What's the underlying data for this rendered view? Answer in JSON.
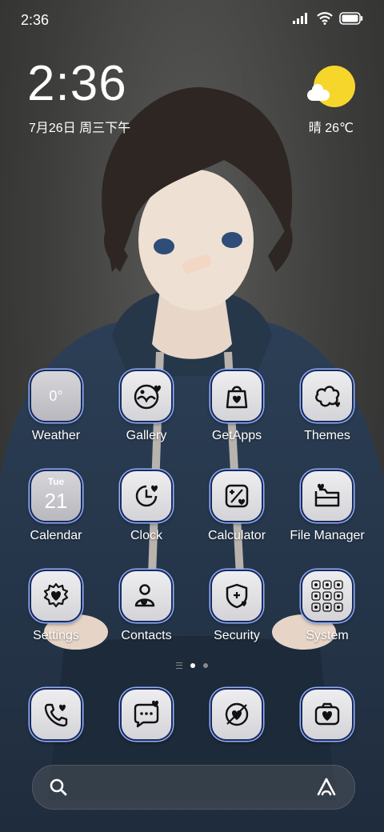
{
  "status_bar": {
    "time": "2:36",
    "icons": [
      "signal-icon",
      "wifi-icon",
      "battery-icon"
    ]
  },
  "clock_widget": {
    "time": "2:36",
    "date": "7月26日 周三下午",
    "weather": "晴 26℃",
    "weather_icon": "sunny-cloud-icon"
  },
  "apps": [
    {
      "label": "Weather",
      "icon": "weather-icon",
      "text": "0°"
    },
    {
      "label": "Gallery",
      "icon": "gallery-icon"
    },
    {
      "label": "GetApps",
      "icon": "shopping-bag-icon"
    },
    {
      "label": "Themes",
      "icon": "themes-icon"
    },
    {
      "label": "Calendar",
      "icon": "calendar-icon",
      "day": "Tue",
      "date": "21"
    },
    {
      "label": "Clock",
      "icon": "clock-icon"
    },
    {
      "label": "Calculator",
      "icon": "calculator-icon"
    },
    {
      "label": "File Manager",
      "icon": "folder-icon"
    },
    {
      "label": "Settings",
      "icon": "gear-icon"
    },
    {
      "label": "Contacts",
      "icon": "contacts-icon"
    },
    {
      "label": "Security",
      "icon": "shield-icon"
    },
    {
      "label": "System",
      "icon": "app-folder-icon"
    }
  ],
  "dock": [
    {
      "icon": "phone-icon"
    },
    {
      "icon": "messages-icon"
    },
    {
      "icon": "browser-icon"
    },
    {
      "icon": "camera-icon"
    }
  ],
  "page_indicator": {
    "pages": 2,
    "active": 0
  },
  "search_bar": {
    "left_icon": "search-icon",
    "right_icon": "assistant-icon"
  },
  "theme": {
    "icon_bg": "#e2e2e6",
    "icon_border": "#1c2a5c",
    "accent": "#8fb3ff",
    "sun": "#f7d62c"
  }
}
